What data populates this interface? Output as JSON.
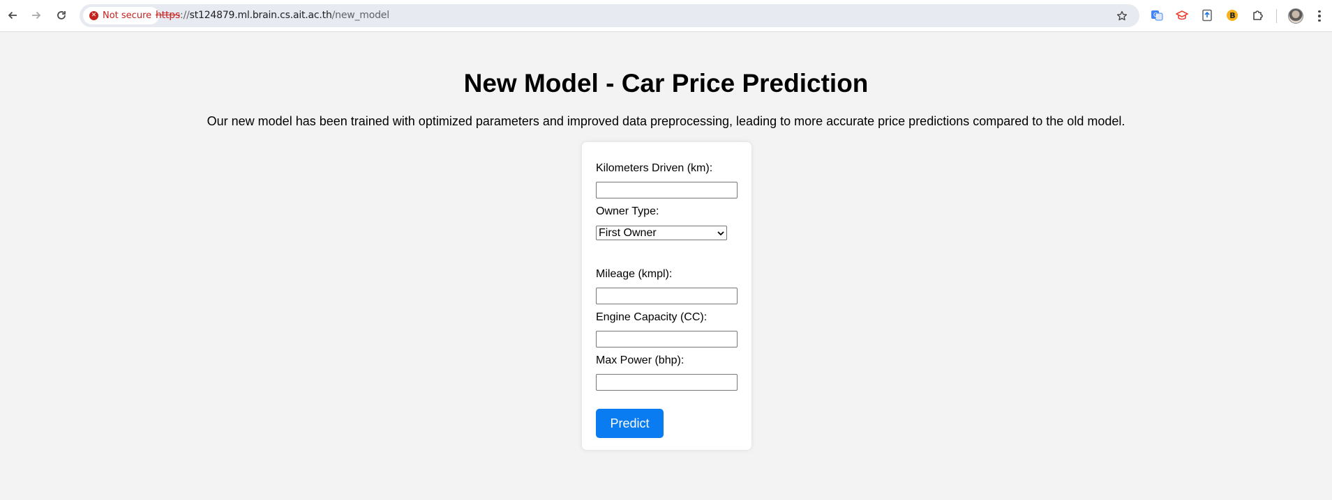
{
  "browser": {
    "security_label": "Not secure",
    "url_scheme": "https",
    "url_separator": "://",
    "url_host": "st124879.ml.brain.cs.ait.ac.th",
    "url_path": "/new_model",
    "extensions": [
      {
        "name": "google-translate-icon",
        "color": "#4285f4"
      },
      {
        "name": "graduation-cap-icon",
        "color": "#ea4335"
      },
      {
        "name": "upload-doc-icon",
        "color": "#1a73e8"
      },
      {
        "name": "b-badge-icon",
        "color": "#f6b21b",
        "letter": "B"
      },
      {
        "name": "extensions-puzzle-icon",
        "color": "#474747"
      }
    ]
  },
  "main": {
    "title": "New Model - Car Price Prediction",
    "description": "Our new model has been trained with optimized parameters and improved data preprocessing, leading to more accurate price predictions compared to the old model."
  },
  "form": {
    "km_label": "Kilometers Driven (km):",
    "km_value": "",
    "owner_label": "Owner Type:",
    "owner_selected": "First Owner",
    "mileage_label": "Mileage (kmpl):",
    "mileage_value": "",
    "engine_label": "Engine Capacity (CC):",
    "engine_value": "",
    "power_label": "Max Power (bhp):",
    "power_value": "",
    "predict_label": "Predict"
  },
  "colors": {
    "accent": "#0a7cf2",
    "page_background": "#f3f3f3",
    "not_secure": "#c5221f"
  }
}
